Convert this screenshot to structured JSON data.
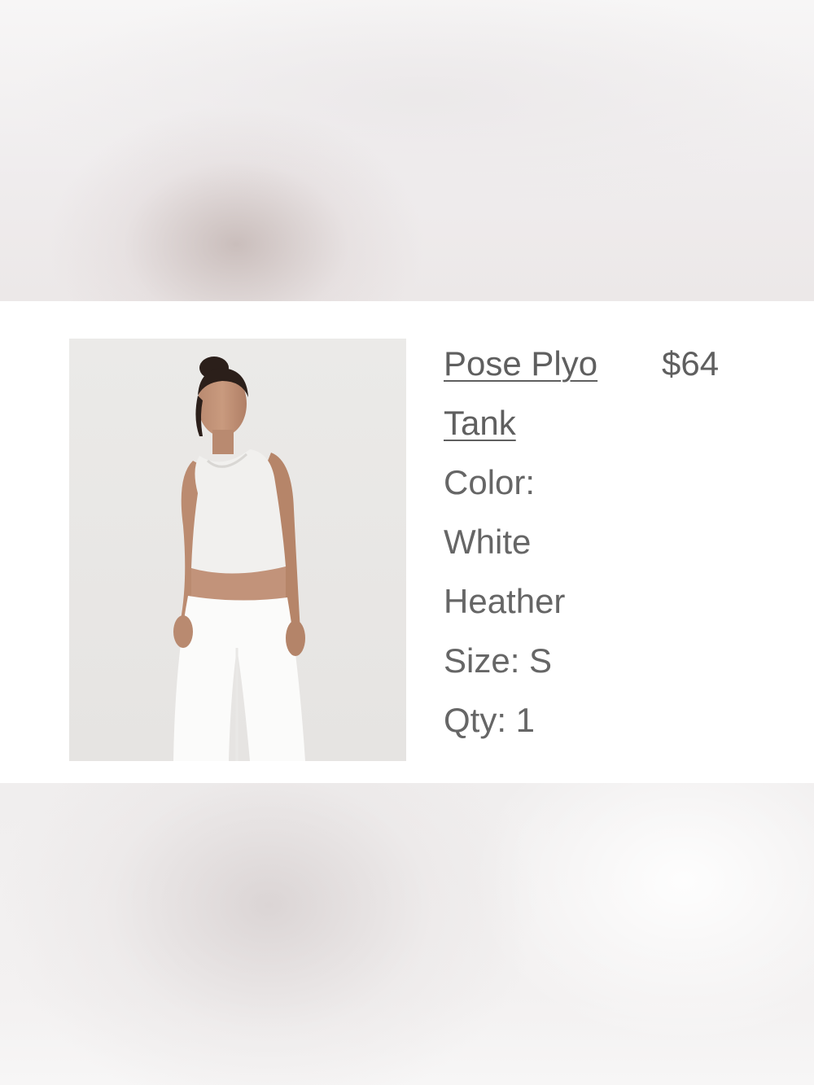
{
  "product": {
    "name": "Pose Plyo Tank",
    "price": "$64",
    "color_label": "Color:",
    "color_value": "White Heather",
    "size": "Size: S",
    "quantity": "Qty: 1"
  }
}
